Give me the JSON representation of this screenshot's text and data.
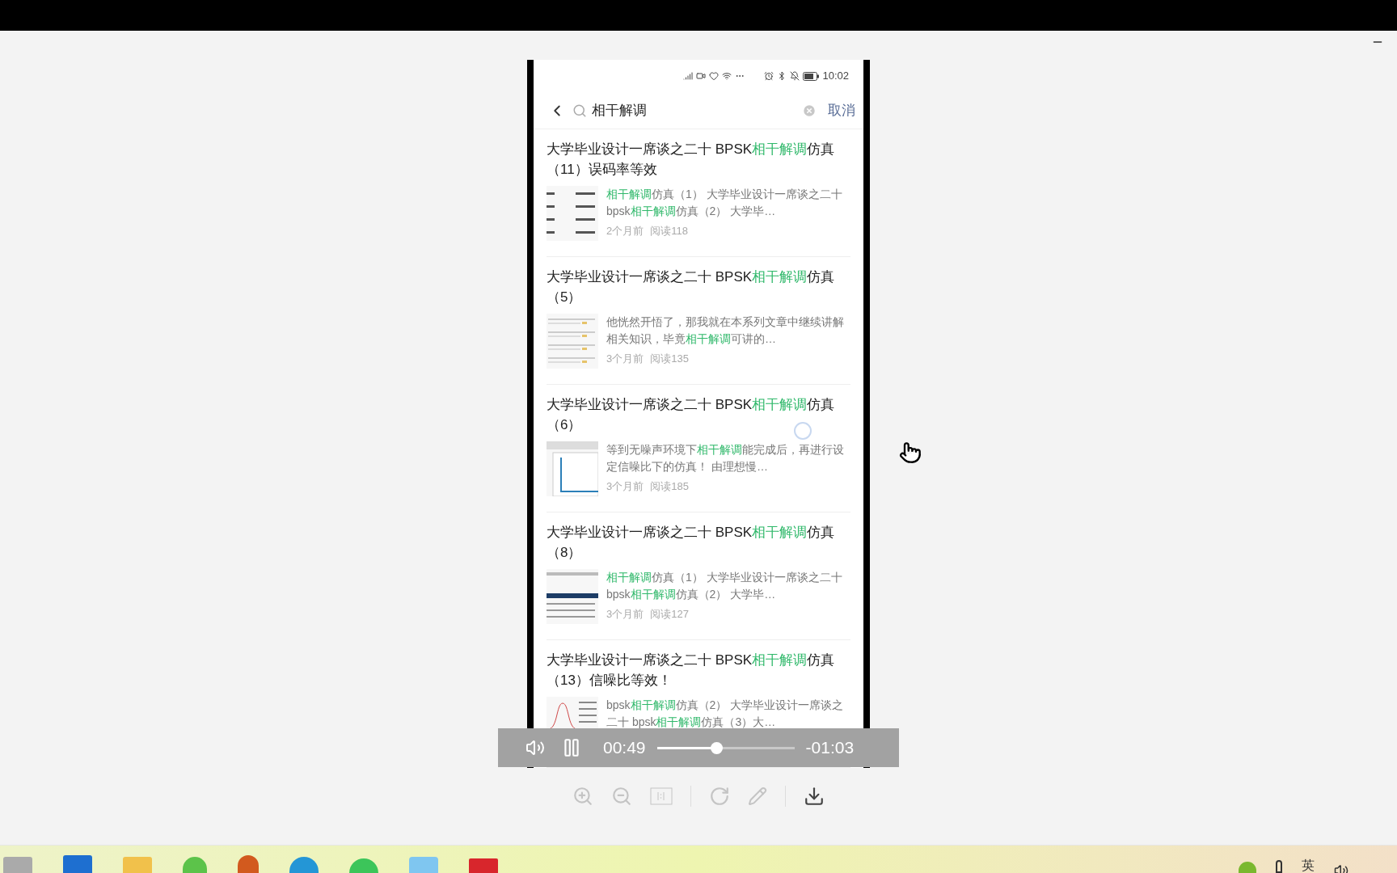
{
  "phone": {
    "status_bar": {
      "time": "10:02"
    },
    "search": {
      "value": "相干解调",
      "cancel": "取消"
    },
    "results": [
      {
        "title": [
          {
            "text": "大学毕业设计一席谈之二十 BPSK",
            "highlight": false
          },
          {
            "text": "相干解调",
            "highlight": true
          },
          {
            "text": "仿真（11）误码率等效",
            "highlight": false
          }
        ],
        "snippet": [
          {
            "text": "相干解调",
            "highlight": true
          },
          {
            "text": "仿真（1） 大学毕业设计一席谈之二十bpsk",
            "highlight": false
          },
          {
            "text": "相干解调",
            "highlight": true
          },
          {
            "text": "仿真（2） 大学毕…",
            "highlight": false
          }
        ],
        "age": "2个月前",
        "reads": "阅读118"
      },
      {
        "title": [
          {
            "text": "大学毕业设计一席谈之二十 BPSK",
            "highlight": false
          },
          {
            "text": "相干解调",
            "highlight": true
          },
          {
            "text": "仿真（5）",
            "highlight": false
          }
        ],
        "snippet": [
          {
            "text": "他恍然开悟了，那我就在本系列文章中继续讲解相关知识，毕竟",
            "highlight": false
          },
          {
            "text": "相干解调",
            "highlight": true
          },
          {
            "text": "可讲的…",
            "highlight": false
          }
        ],
        "age": "3个月前",
        "reads": "阅读135"
      },
      {
        "title": [
          {
            "text": "大学毕业设计一席谈之二十 BPSK",
            "highlight": false
          },
          {
            "text": "相干解调",
            "highlight": true
          },
          {
            "text": "仿真（6）",
            "highlight": false
          }
        ],
        "snippet": [
          {
            "text": "等到无噪声环境下",
            "highlight": false
          },
          {
            "text": "相干解调",
            "highlight": true
          },
          {
            "text": "能完成后，再进行设定信噪比下的仿真！ 由理想慢…",
            "highlight": false
          }
        ],
        "age": "3个月前",
        "reads": "阅读185"
      },
      {
        "title": [
          {
            "text": "大学毕业设计一席谈之二十 BPSK",
            "highlight": false
          },
          {
            "text": "相干解调",
            "highlight": true
          },
          {
            "text": "仿真（8）",
            "highlight": false
          }
        ],
        "snippet": [
          {
            "text": "相干解调",
            "highlight": true
          },
          {
            "text": "仿真（1） 大学毕业设计一席谈之二十bpsk",
            "highlight": false
          },
          {
            "text": "相干解调",
            "highlight": true
          },
          {
            "text": "仿真（2） 大学毕…",
            "highlight": false
          }
        ],
        "age": "3个月前",
        "reads": "阅读127"
      },
      {
        "title": [
          {
            "text": "大学毕业设计一席谈之二十 BPSK",
            "highlight": false
          },
          {
            "text": "相干解调",
            "highlight": true
          },
          {
            "text": "仿真（13）信噪比等效！",
            "highlight": false
          }
        ],
        "snippet": [
          {
            "text": "bpsk",
            "highlight": false
          },
          {
            "text": "相干解调",
            "highlight": true
          },
          {
            "text": "仿真（2） 大学毕业设计一席谈之二十 bpsk",
            "highlight": false
          },
          {
            "text": "相干解调",
            "highlight": true
          },
          {
            "text": "仿真（3）大…",
            "highlight": false
          }
        ]
      }
    ]
  },
  "player": {
    "playing": true,
    "elapsed": "00:49",
    "remaining": "-01:03",
    "level": 0.43
  },
  "taskbar": {
    "ime": "英"
  }
}
